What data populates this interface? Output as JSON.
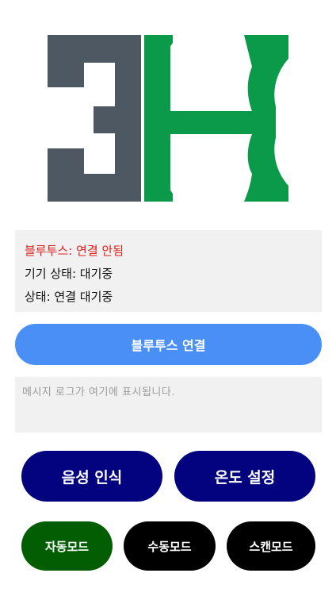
{
  "logo": {
    "icon": "3h-logo-icon",
    "colors": {
      "left": "#4e5862",
      "right": "#0a9a49"
    }
  },
  "status": {
    "bluetooth": "블루투스: 연결 안됨",
    "device": "기기 상태: 대기중",
    "connection": "상태: 연결 대기중"
  },
  "bluetooth_button": {
    "label": "블루투스 연결"
  },
  "log": {
    "placeholder": "메시지 로그가 여기에 표시됩니다."
  },
  "buttons": {
    "voice": "음성 인식",
    "temperature": "온도 설정",
    "auto_mode": "자동모드",
    "manual_mode": "수동모드",
    "scan_mode": "스캔모드"
  },
  "colors": {
    "bluetooth_button": "#4a8ff5",
    "primary_navy": "#03037f",
    "auto_green": "#035d03",
    "black": "#000000",
    "error_red": "#e0201b"
  }
}
